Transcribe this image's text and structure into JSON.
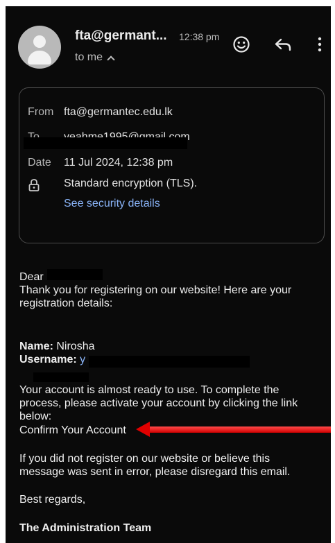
{
  "header": {
    "sender": "fta@germant...",
    "time": "12:38 pm",
    "recipient": "to me",
    "icons": [
      "smiley-icon",
      "reply-icon",
      "more-vert-icon"
    ]
  },
  "details": {
    "from_label": "From",
    "from_value": "fta@germantec.edu.lk",
    "to_label": "To",
    "to_value": "yeahme1995@gmail.com",
    "date_label": "Date",
    "date_value": "11 Jul 2024, 12:38 pm",
    "encryption": "Standard encryption (TLS).",
    "security_link": "See security details"
  },
  "message": {
    "greeting": "Dear",
    "intro_line1": "Thank you for registering on our website! Here are your",
    "intro_line2": "registration details:",
    "name_label": "Name:",
    "name_value": "Nirosha",
    "username_label": "Username:",
    "username_value": "y",
    "activate_line1": "Your account is almost ready to use. To complete the",
    "activate_line2": "process, please activate your account by clicking the link",
    "activate_line3": "below:",
    "confirm_link": "Confirm Your Account",
    "disclaimer_line1": "If you did not register on our website or believe this",
    "disclaimer_line2": "message was sent in error, please disregard this email.",
    "closing": "Best regards,",
    "signature": "The Administration Team"
  },
  "colors": {
    "background": "#0a0a0a",
    "link": "#8ab4f8",
    "annotation_arrow": "#e00000"
  }
}
